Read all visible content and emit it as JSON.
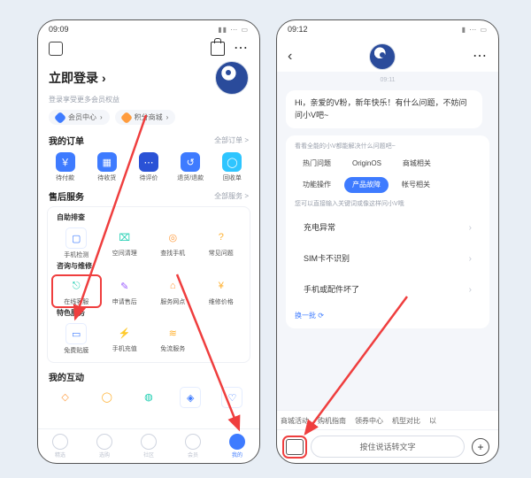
{
  "left": {
    "status_time": "09:09",
    "login_title": "立即登录",
    "login_sub": "登录享受更多会员权益",
    "pills": [
      "会员中心",
      "积分商城"
    ],
    "orders": {
      "title": "我的订单",
      "more": "全部订单 >",
      "items": [
        "待付款",
        "待收货",
        "待评价",
        "退货/退款",
        "回收单"
      ]
    },
    "after": {
      "title": "售后服务",
      "more": "全部服务 >",
      "self_title": "自助排查",
      "self_items": [
        "手机检测",
        "空间清理",
        "查找手机",
        "常见问题"
      ],
      "consult_title": "咨询与维修",
      "consult_items": [
        "在线客服",
        "申请售后",
        "服务网点",
        "维修价格"
      ],
      "special_title": "特色服务",
      "special_items": [
        "免费贴膜",
        "手机充值",
        "免流服务"
      ]
    },
    "inter_title": "我的互动",
    "nav": [
      "精选",
      "选购",
      "社区",
      "会员",
      "我的"
    ]
  },
  "right": {
    "status_time": "09:12",
    "ts": "09:11",
    "greet": "Hi，亲爱的V粉，新年快乐！有什么问题，不妨问问小V吧~",
    "panel_hint": "看看全能的小V都能解决什么问题吧~",
    "chips": [
      "热门问题",
      "OriginOS",
      "商城相关",
      "功能操作",
      "产品故障",
      "帐号相关"
    ],
    "chip_active_index": 4,
    "direct_hint": "您可以直接输入关键词或像这样问小V哦",
    "faq": [
      "充电异常",
      "SIM卡不识别",
      "手机或配件坏了"
    ],
    "swap": "换一批 ⟳",
    "suggestions": [
      "商城活动",
      "购机指南",
      "领券中心",
      "机型对比",
      "以"
    ],
    "voice_label": "按住说话转文字"
  }
}
